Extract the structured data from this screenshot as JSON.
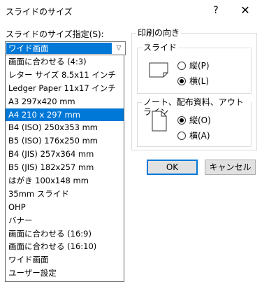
{
  "window": {
    "title": "スライドのサイズ",
    "help_glyph": "?",
    "close_glyph": "✕"
  },
  "size_selector": {
    "label": "スライドのサイズ指定(S):",
    "selected_value": "ワイド画面",
    "arrow_glyph": "▽"
  },
  "dropdown": {
    "items": [
      "画面に合わせる (4:3)",
      "レター サイズ 8.5x11 インチ",
      "Ledger Paper 11x17 インチ",
      "A3 297x420 mm",
      "A4 210 x 297 mm",
      "B4 (ISO) 250x353 mm",
      "B5 (ISO) 176x250 mm",
      "B4 (JIS) 257x364 mm",
      "B5 (JIS) 182x257 mm",
      "はがき 100x148 mm",
      "35mm スライド",
      "OHP",
      "バナー",
      "画面に合わせる (16:9)",
      "画面に合わせる (16:10)",
      "ワイド画面",
      "ユーザー設定"
    ],
    "highlighted_item": "A4 210 x 297 mm"
  },
  "orientation": {
    "title": "印刷の向き",
    "slides": {
      "title": "スライド",
      "portrait_label": "縦(P)",
      "landscape_label": "横(L)",
      "selected": "landscape"
    },
    "notes": {
      "title": "ノート、配布資料、アウトライン",
      "portrait_label": "縦(O)",
      "landscape_label": "横(A)",
      "selected": "portrait"
    }
  },
  "buttons": {
    "ok": "OK",
    "cancel": "キャンセル"
  },
  "colors": {
    "accent": "#0078d7",
    "button_face": "#e1e1e1"
  }
}
